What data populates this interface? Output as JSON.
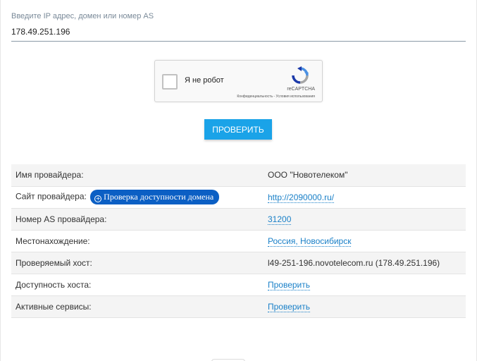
{
  "search": {
    "label": "Введите IP адрес, домен или номер AS",
    "value": "178.49.251.196"
  },
  "captcha": {
    "label": "Я не робот",
    "brand": "reCAPTCHA",
    "links": "Конфиденциальность - Условия использования",
    "icon": "recaptcha-icon"
  },
  "check_button": {
    "label": "ПРОВЕРИТЬ",
    "color": "#1aa3e8"
  },
  "domain_check_pill": {
    "label": "Проверка доступности домена",
    "icon": "circle-plus-icon",
    "color": "#0b5fc4"
  },
  "rows": [
    {
      "key": "Имя провайдера:",
      "value": "ООО \"Новотелеком\""
    },
    {
      "key": "Сайт провайдера:",
      "value": "http://2090000.ru/"
    },
    {
      "key": "Номер AS провайдера:",
      "value": "31200"
    },
    {
      "key": "Местонахождение:",
      "value": "Россия, Новосибирск"
    },
    {
      "key": "Проверяемый хост:",
      "value": "l49-251-196.novotelecom.ru (178.49.251.196)"
    },
    {
      "key": "Доступность хоста:",
      "value": "Проверить"
    },
    {
      "key": "Активные сервисы:",
      "value": "Проверить"
    }
  ],
  "colors": {
    "link": "#1a80c8",
    "row_shade": "#f4f4f4"
  }
}
